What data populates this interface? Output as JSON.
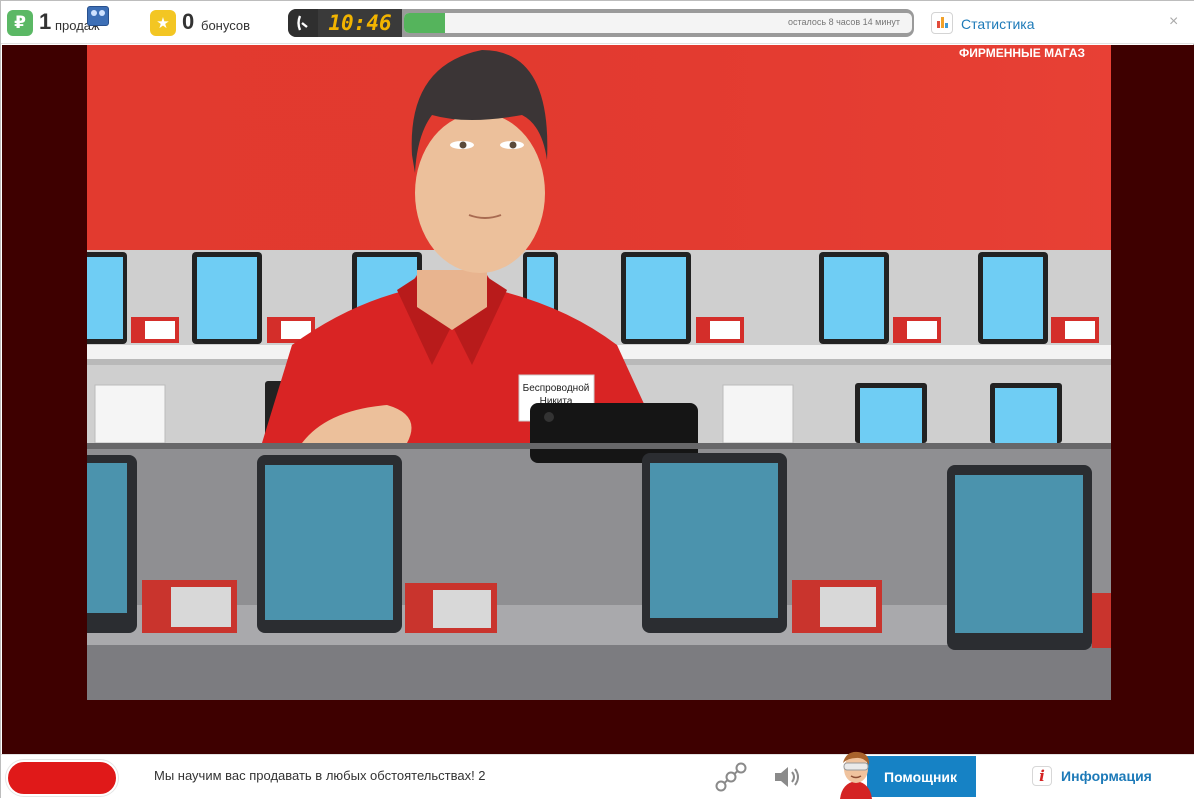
{
  "header": {
    "sales_count": "1",
    "sales_label": "продаж",
    "currency_icon": "ruble-icon",
    "bonus_count": "0",
    "bonus_label": "бонусов",
    "bonus_icon": "star-icon",
    "clock_time": "10:46",
    "progress_fraction": 0.08,
    "time_remaining": "осталось 8 часов 14 минут",
    "stats_label": "Статистика",
    "close_label": "×"
  },
  "scene": {
    "store_sign": "ФИРМЕННЫЕ МАГАЗ",
    "badge_line1": "Беспроводной",
    "badge_line2": "Никита"
  },
  "footer": {
    "ticker_text": "Мы научим вас продавать в любых обстоятельствах! 2",
    "helper_label": "Помощник",
    "info_label": "Информация",
    "info_glyph": "i"
  },
  "colors": {
    "brand_red": "#e01919",
    "accent_blue": "#1682c5",
    "timer_digits": "#f2b400",
    "progress_green": "#55b45c"
  }
}
